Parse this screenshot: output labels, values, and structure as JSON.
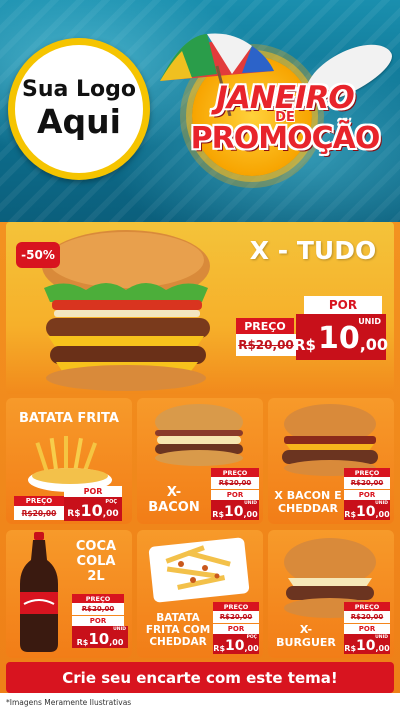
{
  "header": {
    "logo_line1": "Sua Logo",
    "logo_line2": "Aqui",
    "promo_line1": "JANEIRO",
    "promo_line2": "DE",
    "promo_line3": "PROMOÇÃO"
  },
  "featured": {
    "name": "X - TUDO",
    "discount": "-50%",
    "preco_label": "PREÇO",
    "old_price": "R$20,00",
    "por_label": "POR",
    "currency": "R$",
    "new_price_int": "10",
    "new_price_dec": ",00",
    "unit": "UNID"
  },
  "products": [
    {
      "name": "BATATA FRITA",
      "preco_label": "PREÇO",
      "old_price": "R$20,00",
      "por_label": "POR",
      "currency": "R$",
      "new_price_int": "10",
      "new_price_dec": ",00",
      "unit": "POÇ"
    },
    {
      "name": "X-\nBACON",
      "preco_label": "PREÇO",
      "old_price": "R$20,00",
      "por_label": "POR",
      "currency": "R$",
      "new_price_int": "10",
      "new_price_dec": ",00",
      "unit": "UNID"
    },
    {
      "name": "X BACON E\nCHEDDAR",
      "preco_label": "PREÇO",
      "old_price": "R$20,00",
      "por_label": "POR",
      "currency": "R$",
      "new_price_int": "10",
      "new_price_dec": ",00",
      "unit": "UNID"
    },
    {
      "name": "COCA\nCOLA\n2L",
      "preco_label": "PREÇO",
      "old_price": "R$20,00",
      "por_label": "POR",
      "currency": "R$",
      "new_price_int": "10",
      "new_price_dec": ",00",
      "unit": "UNID"
    },
    {
      "name": "BATATA\nFRITA COM\nCHEDDAR",
      "preco_label": "PREÇO",
      "old_price": "R$20,00",
      "por_label": "POR",
      "currency": "R$",
      "new_price_int": "10",
      "new_price_dec": ",00",
      "unit": "POÇ"
    },
    {
      "name": "X-\nBURGUER",
      "preco_label": "PREÇO",
      "old_price": "R$20,00",
      "por_label": "POR",
      "currency": "R$",
      "new_price_int": "10",
      "new_price_dec": ",00",
      "unit": "UNID"
    }
  ],
  "footer": {
    "cta": "Crie seu encarte com este tema!",
    "disclaimer": "*Imagens Meramente Ilustrativas"
  },
  "colors": {
    "brand_red": "#d8141f",
    "orange": "#f39220",
    "pool_blue": "#1a8fae",
    "sun_yellow": "#ffd13a"
  },
  "icons": [
    "beach-umbrella-icon",
    "sun-icon",
    "surfboard-icon",
    "burger-image",
    "fries-image",
    "soda-bottle-image"
  ]
}
